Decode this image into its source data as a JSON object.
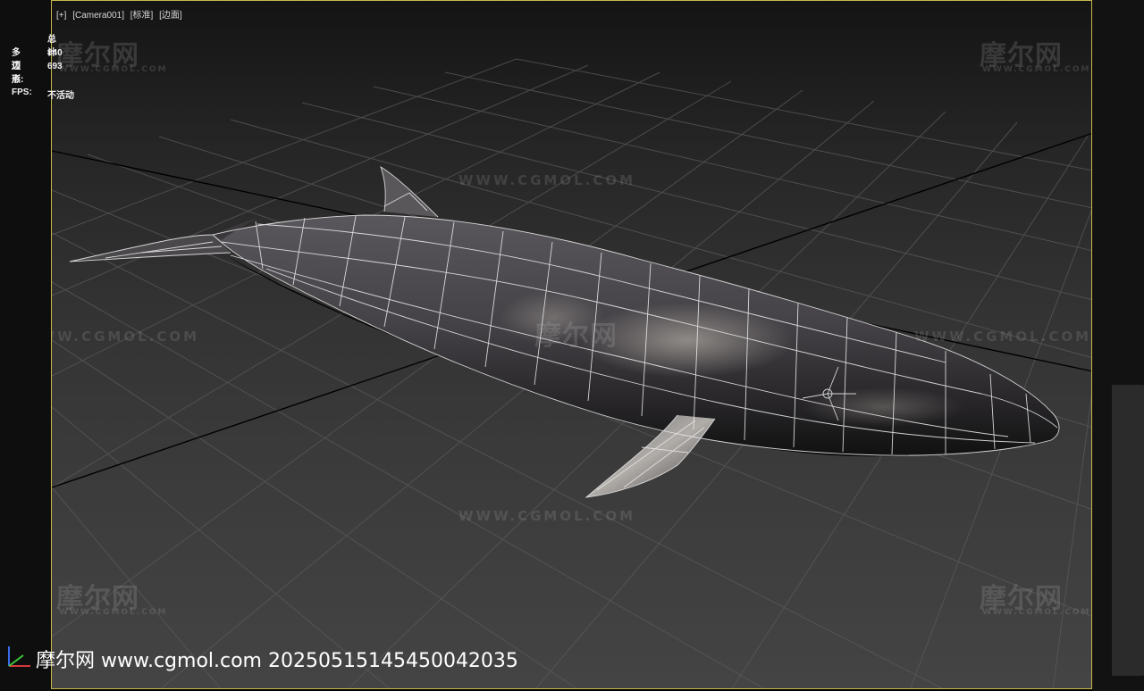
{
  "viewport": {
    "menu": {
      "plus": "[+]",
      "camera": "[Camera001]",
      "shading": "[标准]",
      "display": "[边面]"
    },
    "stats": {
      "header": "总计",
      "polygons_label": "多边形:",
      "polygons_value": "840",
      "vertices_label": "顶点:",
      "vertices_value": "693",
      "fps_label": "FPS:",
      "fps_value": "不活动"
    },
    "model": "whale-wireframe",
    "border_color": "#c8b84a"
  },
  "watermarks": {
    "logo_text": "摩尔网",
    "logo_sub": "WWW.CGMOL.COM",
    "url_text": "WWW.CGMOL.COM"
  },
  "caption": {
    "text": "摩尔网 www.cgmol.com 20250515145450042035"
  },
  "colors": {
    "accent": "#c8b84a",
    "text": "#f0f0f0"
  }
}
